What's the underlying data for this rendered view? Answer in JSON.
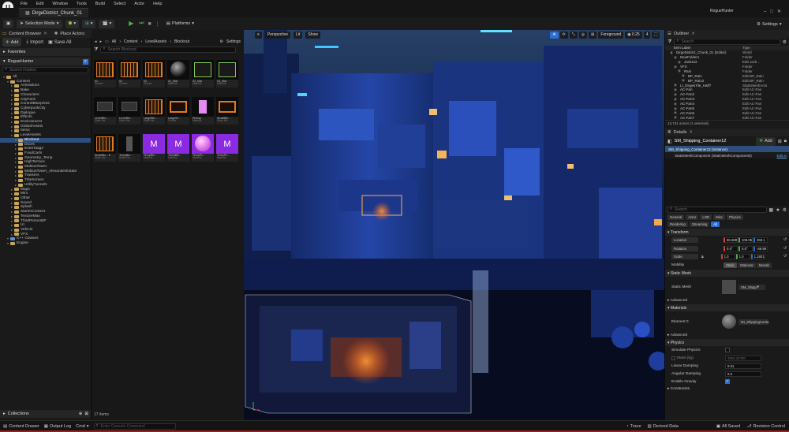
{
  "menu": [
    "File",
    "Edit",
    "Window",
    "Tools",
    "Build",
    "Select",
    "Actor",
    "Help"
  ],
  "app": {
    "project_name": "RogueHunter",
    "level_tab": "DirgeDistrict_Chunk_01",
    "settings_label": "Settings"
  },
  "toolbar": {
    "mode": "Selection Mode",
    "platforms": "Platforms"
  },
  "content_browser": {
    "tab_label": "Content Browser",
    "tab2_label": "Place Actors",
    "add_label": "Add",
    "import_label": "Import",
    "save_all_label": "Save All",
    "breadcrumb": [
      "All",
      "Content",
      "LevelAssets",
      "Blockout"
    ],
    "settings_label": "Settings",
    "favorites_label": "Favorites",
    "project_label": "RogueHunter",
    "search_folders": "Search Folders",
    "search_assets": "Search Blockout",
    "tree": [
      {
        "label": "All",
        "depth": 0
      },
      {
        "label": "Content",
        "depth": 1
      },
      {
        "label": "Animations",
        "depth": 2
      },
      {
        "label": "Bake",
        "depth": 2
      },
      {
        "label": "Characters",
        "depth": 2
      },
      {
        "label": "CityPack",
        "depth": 2
      },
      {
        "label": "ControlBlueprints",
        "depth": 2
      },
      {
        "label": "CyberpunkCity",
        "depth": 2
      },
      {
        "label": "Dialogue",
        "depth": 2
      },
      {
        "label": "Effects",
        "depth": 2
      },
      {
        "label": "Environment",
        "depth": 2
      },
      {
        "label": "GlobalAssets",
        "depth": 2
      },
      {
        "label": "Items",
        "depth": 2
      },
      {
        "label": "LevelAssets",
        "depth": 2
      },
      {
        "label": "Blockout",
        "depth": 3,
        "selected": true
      },
      {
        "label": "Doors",
        "depth": 3
      },
      {
        "label": "EnterStage",
        "depth": 3
      },
      {
        "label": "FoodCarts",
        "depth": 3
      },
      {
        "label": "Geometry_Temp",
        "depth": 3
      },
      {
        "label": "HighTerrace",
        "depth": 3
      },
      {
        "label": "MobiusTower",
        "depth": 3
      },
      {
        "label": "MobiusTower_AlexanderEstate",
        "depth": 3
      },
      {
        "label": "Trackers",
        "depth": 3
      },
      {
        "label": "TriteScreen",
        "depth": 3
      },
      {
        "label": "UtilityTunnels",
        "depth": 3
      },
      {
        "label": "Maps",
        "depth": 2
      },
      {
        "label": "Mini",
        "depth": 2
      },
      {
        "label": "Other",
        "depth": 2
      },
      {
        "label": "Sound",
        "depth": 2
      },
      {
        "label": "Splash",
        "depth": 2
      },
      {
        "label": "StarterContent",
        "depth": 2
      },
      {
        "label": "TextureMax",
        "depth": 2
      },
      {
        "label": "ThirdPersonBP",
        "depth": 2
      },
      {
        "label": "UI",
        "depth": 2
      },
      {
        "label": "Vehicle",
        "depth": 2
      },
      {
        "label": "VFX",
        "depth": 2
      },
      {
        "label": "C++ Classes",
        "depth": 1
      },
      {
        "label": "Engine",
        "depth": 1
      }
    ],
    "assets": [
      {
        "name": "01",
        "type": "Texture",
        "thumb": "orange-grid"
      },
      {
        "name": "02",
        "type": "Texture",
        "thumb": "orange-grid"
      },
      {
        "name": "03",
        "type": "Texture",
        "thumb": "orange-grid"
      },
      {
        "name": "01_Mat",
        "type": "Material",
        "thumb": "sphere-dark"
      },
      {
        "name": "02_Mat",
        "type": "Material",
        "thumb": "green-frame"
      },
      {
        "name": "03_Mat",
        "type": "Material",
        "thumb": "green-frame"
      },
      {
        "name": "LevelBlo…",
        "type": "Static Me…",
        "thumb": "dark-box"
      },
      {
        "name": "LevelBlo…",
        "type": "Static Me…",
        "thumb": "dark-box"
      },
      {
        "name": "LargeBlo…",
        "type": "Static Me…",
        "thumb": "orange-grid"
      },
      {
        "name": "LargeW…",
        "type": "Texture",
        "thumb": "orange-frame"
      },
      {
        "name": "Pickup",
        "type": "Material",
        "thumb": "pink-box"
      },
      {
        "name": "SmallBlo…",
        "type": "Static Me…",
        "thumb": "orange-frame"
      },
      {
        "name": "SmallBlo…E",
        "type": "Static Me…",
        "thumb": "orange-grid"
      },
      {
        "name": "TempBlo…",
        "type": "Static Me…",
        "thumb": "dark-pillar"
      },
      {
        "name": "TempBlo…",
        "type": "Material",
        "thumb": "purple-logo"
      },
      {
        "name": "TempBlo…",
        "type": "Material",
        "thumb": "purple-logo"
      },
      {
        "name": "TempPu…",
        "type": "Material",
        "thumb": "pink-sphere"
      },
      {
        "name": "TempPu…",
        "type": "Material",
        "thumb": "purple-logo"
      }
    ],
    "item_count": "17 items",
    "collections_label": "Collections"
  },
  "viewport": {
    "perspective": "Perspective",
    "lit": "Lit",
    "show": "Show",
    "foreground": "Foreground",
    "speed": "0.25",
    "snap": "4"
  },
  "outliner": {
    "tab_label": "Outliner",
    "search": "Search",
    "col_label": "Item Label",
    "col_type": "Type",
    "rows": [
      {
        "label": "DirgeDistrict_Chunk_01 (Editor)",
        "type": "World",
        "depth": 0
      },
      {
        "label": "NewFolder1",
        "type": "Folder",
        "depth": 1
      },
      {
        "label": "Jack4z2",
        "type": "Edit Jack…",
        "depth": 2,
        "link": true
      },
      {
        "label": "VFX",
        "type": "Folder",
        "depth": 1
      },
      {
        "label": "Rain",
        "type": "Folder",
        "depth": 2
      },
      {
        "label": "BP_Rain",
        "type": "Edit BP_Rain",
        "depth": 3,
        "link": true
      },
      {
        "label": "BP_Rain2",
        "type": "Edit BP_Rain",
        "depth": 3,
        "link": true
      },
      {
        "label": "LI_DirgesTile_Half7",
        "type": "StaticMeshActo",
        "depth": 1
      },
      {
        "label": "AC-Fan",
        "type": "Edit AC-Fan",
        "depth": 1,
        "link": true
      },
      {
        "label": "AC-Fan2",
        "type": "Edit AC-Fan",
        "depth": 1,
        "link": true
      },
      {
        "label": "AC-Fan3",
        "type": "Edit AC-Fan",
        "depth": 1,
        "link": true
      },
      {
        "label": "AC-Fan4",
        "type": "Edit AC-Fan",
        "depth": 1,
        "link": true
      },
      {
        "label": "AC-Fan5",
        "type": "Edit AC-Fan",
        "depth": 1,
        "link": true
      },
      {
        "label": "AC-Fan6",
        "type": "Edit AC-Fan",
        "depth": 1,
        "link": true
      },
      {
        "label": "AC-Fan7",
        "type": "Edit AC-Fan",
        "depth": 1,
        "link": true
      }
    ],
    "actor_count": "13,731 actors (1 selected)"
  },
  "details": {
    "tab_label": "Details",
    "object_name": "SM_Shipping_Container12",
    "add_label": "Add",
    "instance_row": "SM_Shipping_Container12 (Instance)",
    "component_row": "StaticMeshComponent (StaticMeshComponent0)",
    "component_link": "Edit in",
    "search": "Search",
    "filters_1": [
      "General",
      "Actor",
      "LOD",
      "Misc",
      "Physics"
    ],
    "filters_2": [
      "Rendering",
      "Streaming",
      "All"
    ],
    "transform_label": "Transform",
    "location_label": "Location",
    "location": [
      "86.688",
      "108.05",
      "260.1"
    ],
    "rotation_label": "Rotation",
    "rotation": [
      "0.0°",
      "0.0°",
      "-89.99"
    ],
    "scale_label": "Scale",
    "scale": [
      "1.0",
      "1.0",
      "1.1801"
    ],
    "mobility_label": "Mobility",
    "mobility": [
      "Static",
      "Stationar",
      "Movab"
    ],
    "static_mesh_section": "Static Mesh",
    "static_mesh_label": "Static Mesh",
    "static_mesh_value": "SM_Shippi",
    "advanced_label": "Advanced",
    "materials_section": "Materials",
    "element_label": "Element 0",
    "element_value": "MI_ShippingConta",
    "advanced2_label": "Advanced",
    "physics_section": "Physics",
    "simulate_label": "Simulate Physics",
    "mass_label": "Mass (kg)",
    "mass_value": "4863.32788",
    "linear_label": "Linear Damping",
    "linear_value": "0.01",
    "angular_label": "Angular Damping",
    "angular_value": "0.0",
    "gravity_label": "Enable Gravity",
    "constraints_label": "Constraints"
  },
  "statusbar": {
    "content_drawer": "Content Drawer",
    "output_log": "Output Log",
    "cmd": "Cmd",
    "console_placeholder": "Enter Console Command",
    "trace": "Trace",
    "derived": "Derived Data",
    "all_saved": "All Saved",
    "revision": "Revision Control"
  },
  "colors": {
    "selection": "#2d4f7c",
    "accent_blue": "#2a6fd6",
    "play_green": "#4caf50",
    "status_red": "#a21b1b",
    "folder": "#c9a55a"
  }
}
